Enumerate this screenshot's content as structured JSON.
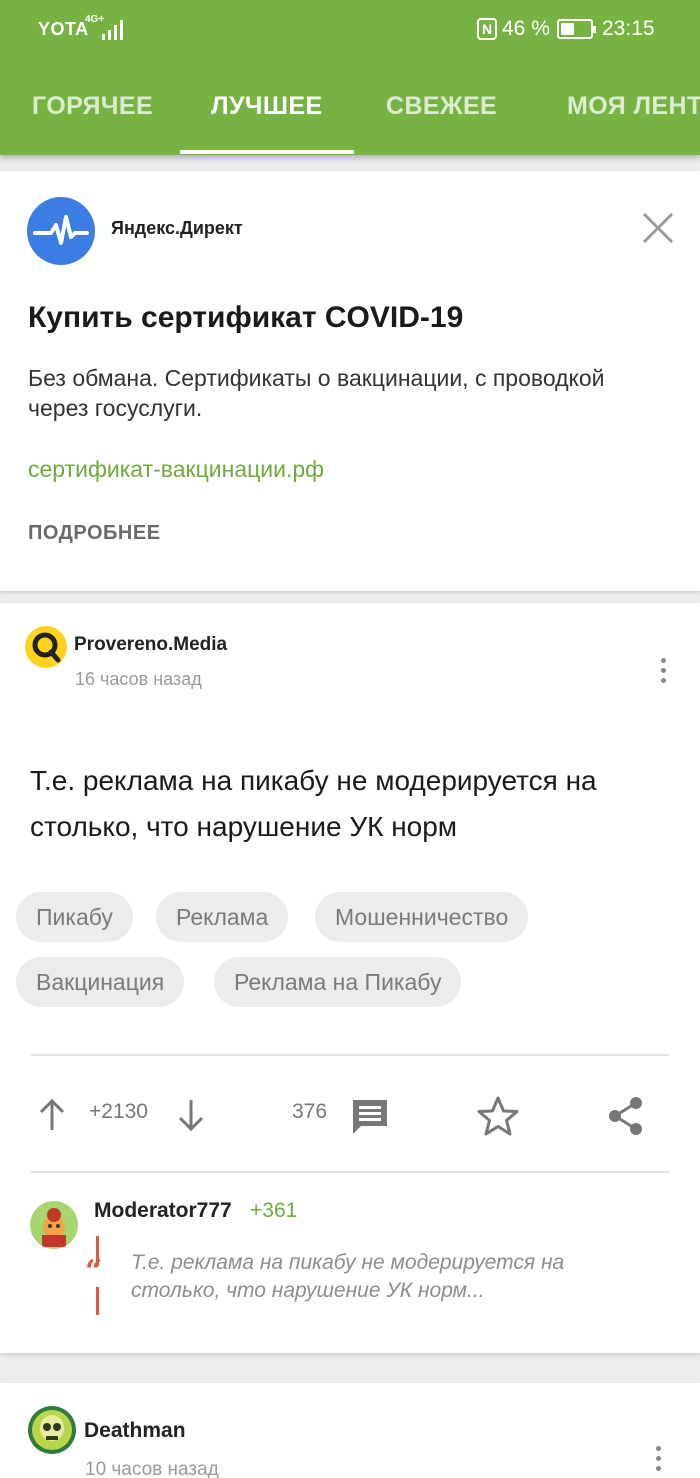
{
  "status_bar": {
    "carrier": "YOTA",
    "network": "4G+",
    "battery_percent": "46 %",
    "battery_level": 0.46,
    "time": "23:15"
  },
  "tabs": [
    {
      "label": "ГОРЯЧЕЕ",
      "active": false
    },
    {
      "label": "ЛУЧШЕЕ",
      "active": true
    },
    {
      "label": "СВЕЖЕЕ",
      "active": false
    },
    {
      "label": "МОЯ ЛЕНТА",
      "active": false
    }
  ],
  "ad": {
    "source": "Яндекс.Директ",
    "title": "Купить сертификат COVID-19",
    "description": "Без обмана. Сертификаты о вакцинации, с проводкой через госуслуги.",
    "link": "сертификат-вакцинации.рф",
    "more_label": "ПОДРОБНЕЕ"
  },
  "post": {
    "author": "Provereno.Media",
    "time": "16 часов назад",
    "text": "Т.е. реклама на пикабу не модерируется на столько, что нарушение УК норм",
    "tags": [
      "Пикабу",
      "Реклама",
      "Мошенничество",
      "Вакцинация",
      "Реклама на Пикабу"
    ],
    "rating": "+2130",
    "comments_count": "376",
    "top_comment": {
      "author": "Moderator777",
      "rating": "+361",
      "quote": "Т.е. реклама на пикабу не модерируется на столько, что нарушение УК норм..."
    }
  },
  "next_post": {
    "author": "Deathman",
    "time": "10 часов назад"
  },
  "colors": {
    "brand_green": "#76b343",
    "link_green": "#6faa3d",
    "quote_red": "#e0573c"
  }
}
